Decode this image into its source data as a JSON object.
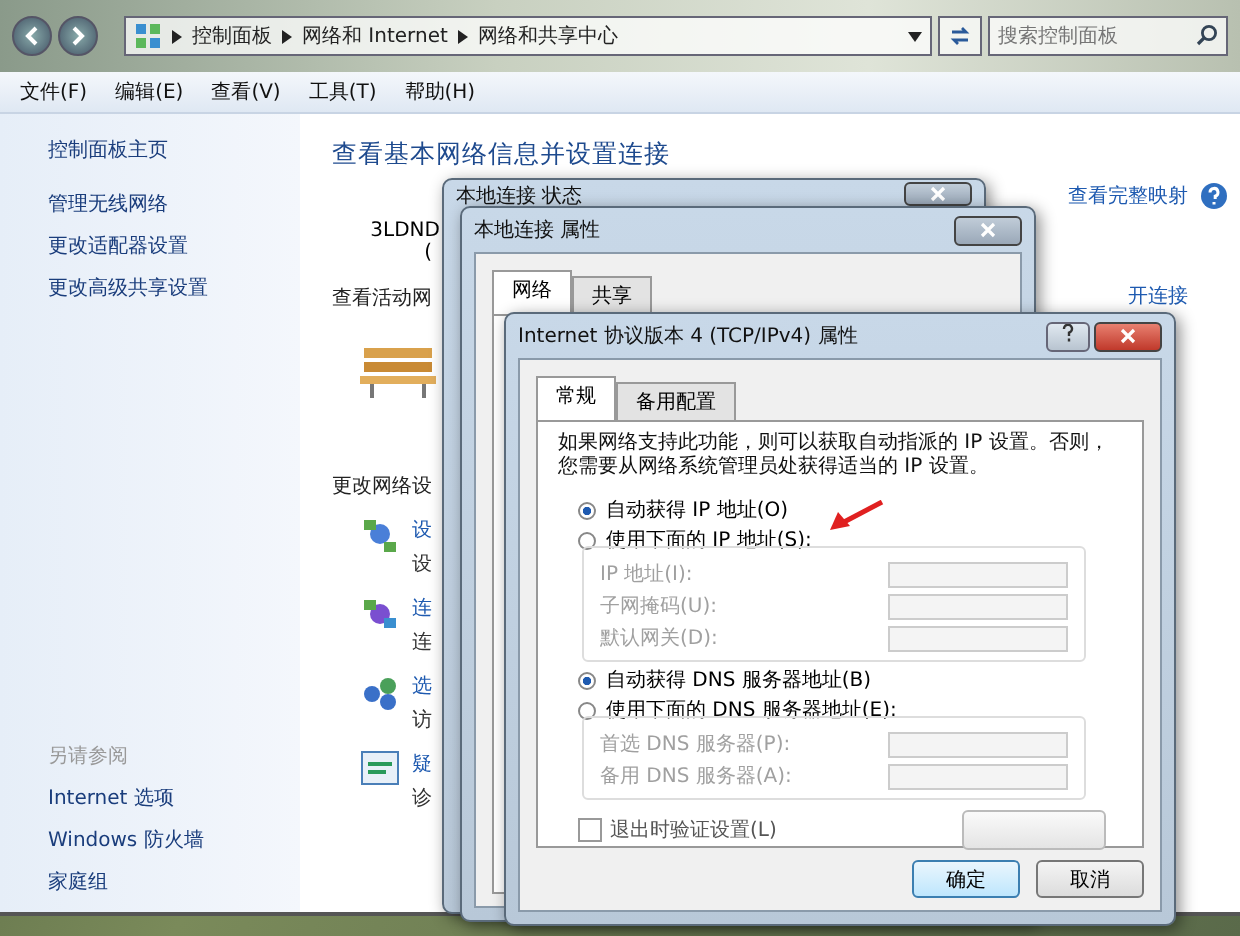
{
  "explorer": {
    "breadcrumb": [
      "控制面板",
      "网络和 Internet",
      "网络和共享中心"
    ],
    "search": {
      "placeholder": "搜索控制面板"
    },
    "menu": [
      "文件(F)",
      "编辑(E)",
      "查看(V)",
      "工具(T)",
      "帮助(H)"
    ],
    "sidebar": {
      "items": [
        "控制面板主页",
        "管理无线网络",
        "更改适配器设置",
        "更改高级共享设置"
      ],
      "see_also_title": "另请参阅",
      "see_also": [
        "Internet 选项",
        "Windows 防火墙",
        "家庭组"
      ]
    },
    "content": {
      "heading": "查看基本网络信息并设置连接",
      "map_link": "查看完整映射",
      "computer_name": "3LDND",
      "computer_note": "(",
      "active_heading": "查看活动网",
      "connect_link": "开连接",
      "settings_heading": "更改网络设",
      "tasks": [
        {
          "kind": "setup",
          "title": "设",
          "desc": "设"
        },
        {
          "kind": "connect",
          "title": "连",
          "desc": "连"
        },
        {
          "kind": "homegroup",
          "title": "选",
          "desc": "访"
        },
        {
          "kind": "troubleshoot",
          "title": "疑",
          "desc": "诊"
        }
      ]
    }
  },
  "status_dialog": {
    "title": "本地连接 状态"
  },
  "properties_dialog": {
    "title": "本地连接 属性",
    "tabs": [
      {
        "label": "网络",
        "selected": true
      },
      {
        "label": "共享",
        "selected": false
      }
    ]
  },
  "ipv4_dialog": {
    "title": "Internet 协议版本 4 (TCP/IPv4) 属性",
    "tabs": [
      {
        "label": "常规",
        "selected": true
      },
      {
        "label": "备用配置",
        "selected": false
      }
    ],
    "intro": "如果网络支持此功能，则可以获取自动指派的 IP 设置。否则，您需要从网络系统管理员处获得适当的 IP 设置。",
    "ip_options": [
      {
        "label": "自动获得 IP 地址(O)",
        "selected": true
      },
      {
        "label": "使用下面的 IP 地址(S):",
        "selected": false
      }
    ],
    "ip_fields": [
      {
        "label": "IP 地址(I):",
        "disabled": true
      },
      {
        "label": "子网掩码(U):",
        "disabled": true
      },
      {
        "label": "默认网关(D):",
        "disabled": true
      }
    ],
    "dns_options": [
      {
        "label": "自动获得 DNS 服务器地址(B)",
        "selected": true
      },
      {
        "label": "使用下面的 DNS 服务器地址(E):",
        "selected": false
      }
    ],
    "dns_fields": [
      {
        "label": "首选 DNS 服务器(P):",
        "disabled": true
      },
      {
        "label": "备用 DNS 服务器(A):",
        "disabled": true
      }
    ],
    "validate": {
      "label": "退出时验证设置(L)",
      "checked": false
    },
    "buttons": [
      "确定",
      "取消"
    ]
  }
}
